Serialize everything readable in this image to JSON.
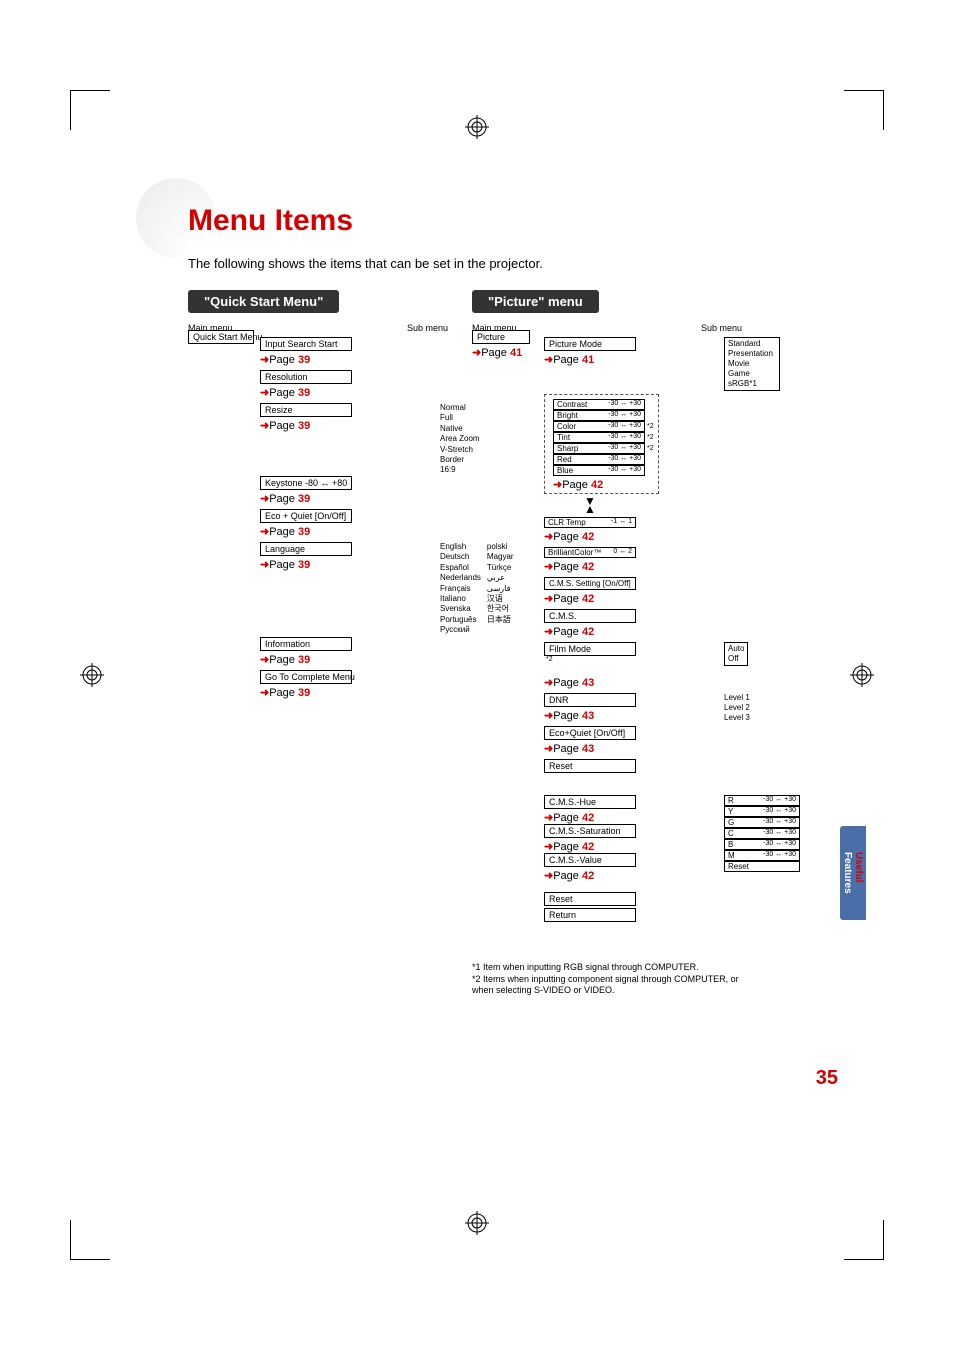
{
  "page_title": "Menu Items",
  "intro": "The following shows the items that can be set in the projector.",
  "page_number": "35",
  "side_tab": {
    "line1": "Useful",
    "line2": "Features"
  },
  "quick": {
    "section_title": "\"Quick Start Menu\"",
    "main_header": "Main menu",
    "sub_header": "Sub menu",
    "main_label": "Quick Start Menu",
    "items": [
      {
        "label": "Input Search Start",
        "page": "39"
      },
      {
        "label": "Resolution",
        "page": "39"
      },
      {
        "label": "Resize",
        "page": "39"
      },
      {
        "label": "Keystone      -80 ↔ +80",
        "page": "39"
      },
      {
        "label": "Eco + Quiet [On/Off]",
        "page": "39"
      },
      {
        "label": "Language",
        "page": "39"
      },
      {
        "label": "Information",
        "page": "39"
      },
      {
        "label": "Go To Complete Menu",
        "page": "39"
      }
    ],
    "resize_options": [
      "Normal",
      "Full",
      "Native",
      "Area Zoom",
      "V-Stretch",
      "Border",
      "16:9"
    ],
    "language_options_a": [
      "English",
      "Deutsch",
      "Español",
      "Nederlands",
      "Français",
      "Italiano",
      "Svenska",
      "Português",
      "Русский"
    ],
    "language_options_b": [
      "polski",
      "Magyar",
      "Türkçe",
      "عربي",
      "فارسی",
      "汉语",
      "한국어",
      "日本語"
    ]
  },
  "picture": {
    "section_title": "\"Picture\" menu",
    "main_header": "Main menu",
    "sub_header": "Sub menu",
    "main_label": "Picture",
    "main_page": "41",
    "mode_label": "Picture Mode",
    "mode_page": "41",
    "mode_options": [
      "Standard",
      "Presentation",
      "Movie",
      "Game",
      "sRGB*1"
    ],
    "adjust_items": [
      {
        "name": "Contrast",
        "range": "-30 ↔ +30",
        "note": ""
      },
      {
        "name": "Bright",
        "range": "-30 ↔ +30",
        "note": ""
      },
      {
        "name": "Color",
        "range": "-30 ↔ +30",
        "note": "*2"
      },
      {
        "name": "Tint",
        "range": "-30 ↔ +30",
        "note": "*2"
      },
      {
        "name": "Sharp",
        "range": "-30 ↔ +30",
        "note": "*2"
      },
      {
        "name": "Red",
        "range": "-30 ↔ +30",
        "note": ""
      },
      {
        "name": "Blue",
        "range": "-30 ↔ +30",
        "note": ""
      }
    ],
    "adjust_page": "42",
    "clr_temp": {
      "label": "CLR Temp",
      "range": "-1 ↔ 1",
      "page": "42"
    },
    "brilliant": {
      "label": "BrilliantColor™",
      "range": "0 ↔ 2",
      "page": "42"
    },
    "cms_setting": {
      "label": "C.M.S. Setting [On/Off]",
      "page": "42"
    },
    "cms": {
      "label": "C.M.S.",
      "page": "42"
    },
    "film_mode": {
      "label": "Film Mode",
      "note": "*2",
      "options": [
        "Auto",
        "Off"
      ],
      "page": "43"
    },
    "dnr": {
      "label": "DNR",
      "options": [
        "Level 1",
        "Level 2",
        "Level 3"
      ],
      "page": "43"
    },
    "ecoquiet": {
      "label": "Eco+Quiet [On/Off]",
      "page": "43"
    },
    "reset": "Reset",
    "cms_detail": {
      "hue": {
        "label": "C.M.S.-Hue",
        "page": "42"
      },
      "sat": {
        "label": "C.M.S.-Saturation",
        "page": "42"
      },
      "val": {
        "label": "C.M.S.-Value",
        "page": "42"
      },
      "channels": [
        {
          "ch": "R",
          "range": "-30 ↔ +30"
        },
        {
          "ch": "Y",
          "range": "-30 ↔ +30"
        },
        {
          "ch": "G",
          "range": "-30 ↔ +30"
        },
        {
          "ch": "C",
          "range": "-30 ↔ +30"
        },
        {
          "ch": "B",
          "range": "-30 ↔ +30"
        },
        {
          "ch": "M",
          "range": "-30 ↔ +30"
        }
      ],
      "reset": "Reset",
      "return": "Return",
      "reset2": "Reset"
    }
  },
  "footnotes": [
    "*1 Item when inputting RGB signal through COMPUTER.",
    "*2 Items when inputting component signal through COMPUTER, or when selecting S-VIDEO or VIDEO."
  ]
}
